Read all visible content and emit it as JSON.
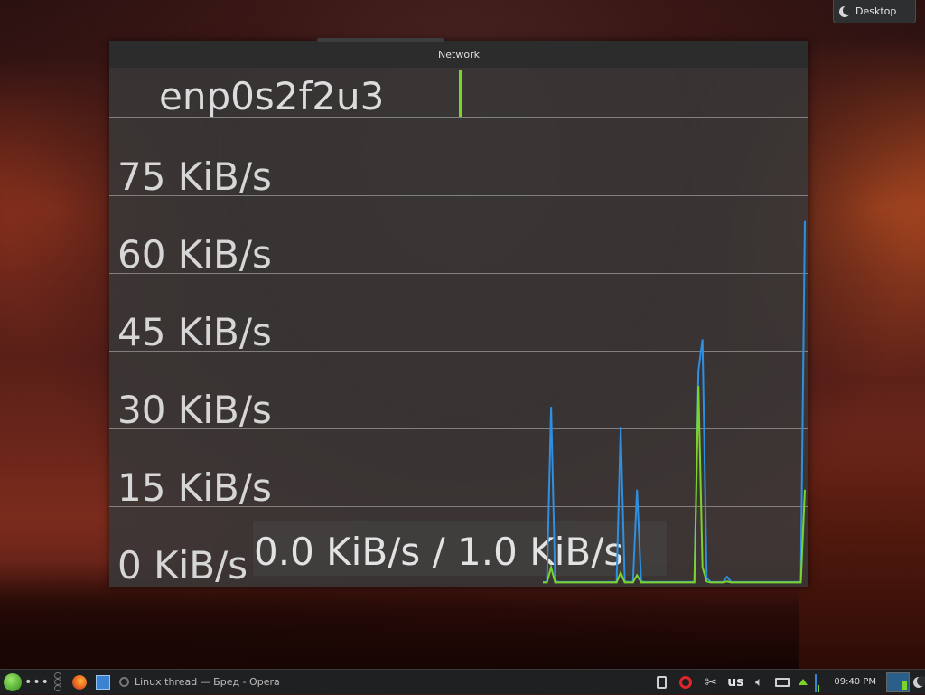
{
  "desktop_pill": {
    "label": "Desktop"
  },
  "window": {
    "title": "Network",
    "interface": "enp0s2f2u3",
    "y_axis_labels": [
      "75 KiB/s",
      "60 KiB/s",
      "45 KiB/s",
      "30 KiB/s",
      "15 KiB/s",
      "0 KiB/s"
    ],
    "rate_readout": "0.0 KiB/s / 1.0 KiB/s",
    "colors": {
      "download": "#2f8fe0",
      "upload": "#7cd42a",
      "grid": "#bebebe"
    }
  },
  "chart_data": {
    "type": "line",
    "ylim": [
      0,
      90
    ],
    "series": [
      {
        "values": [
          0.2,
          0.2,
          34,
          0.3,
          0.2,
          0.2,
          0.2,
          0.2,
          0.2,
          0.2,
          0.2,
          0.2,
          0.2,
          0.2,
          0.2,
          0.2,
          0.2,
          0.2,
          0.2,
          30,
          0.3,
          0.2,
          0.2,
          18,
          0.3,
          0.2,
          0.2,
          0.2,
          0.2,
          0.2,
          0.2,
          0.2,
          0.2,
          0.2,
          0.2,
          0.2,
          0.2,
          0.2,
          41,
          47,
          1.0,
          0.2,
          0.2,
          0.2,
          0.2,
          1.2,
          0.2,
          0.2,
          0.2,
          0.2,
          0.2,
          0.2,
          0.2,
          0.2,
          0.2,
          0.2,
          0.2,
          0.2,
          0.2,
          0.2,
          0.2,
          0.2,
          0.2,
          0.2,
          70
        ]
      },
      {
        "values": [
          0.1,
          0.1,
          3,
          0.1,
          0.1,
          0.1,
          0.1,
          0.1,
          0.1,
          0.1,
          0.1,
          0.1,
          0.1,
          0.1,
          0.1,
          0.1,
          0.1,
          0.1,
          0.1,
          2,
          0.1,
          0.1,
          0.1,
          1.5,
          0.1,
          0.1,
          0.1,
          0.1,
          0.1,
          0.1,
          0.1,
          0.1,
          0.1,
          0.1,
          0.1,
          0.1,
          0.1,
          0.1,
          38,
          3,
          0.3,
          0.1,
          0.1,
          0.1,
          0.1,
          0.3,
          0.1,
          0.1,
          0.1,
          0.1,
          0.1,
          0.1,
          0.1,
          0.1,
          0.1,
          0.1,
          0.1,
          0.1,
          0.1,
          0.1,
          0.1,
          0.1,
          0.1,
          0.1,
          18
        ]
      }
    ]
  },
  "taskbar": {
    "task_title": "Linux thread — Бред - Opera",
    "keyboard_layout": "us",
    "clock": "09:40 PM"
  }
}
